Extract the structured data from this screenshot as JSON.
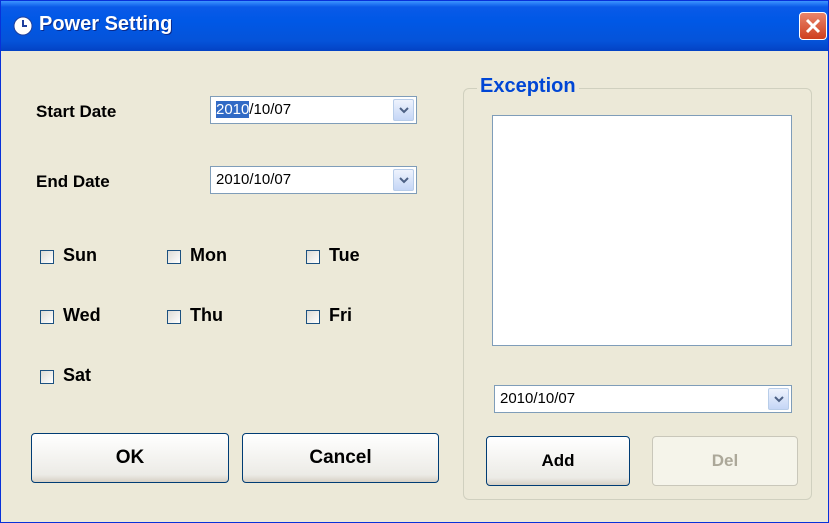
{
  "window": {
    "title": "Power Setting"
  },
  "icons": {
    "title": "clock-icon",
    "close": "close-icon",
    "dropdown": "chevron-down-icon"
  },
  "start_date": {
    "label": "Start Date",
    "value_selected": "2010",
    "value_rest": "/10/07"
  },
  "end_date": {
    "label": "End Date",
    "value": "2010/10/07"
  },
  "days": [
    {
      "label": "Sun",
      "checked": false
    },
    {
      "label": "Mon",
      "checked": false
    },
    {
      "label": "Tue",
      "checked": false
    },
    {
      "label": "Wed",
      "checked": false
    },
    {
      "label": "Thu",
      "checked": false
    },
    {
      "label": "Fri",
      "checked": false
    },
    {
      "label": "Sat",
      "checked": false
    }
  ],
  "buttons": {
    "ok": "OK",
    "cancel": "Cancel"
  },
  "exception": {
    "title": "Exception",
    "items": [],
    "date": "2010/10/07",
    "add": "Add",
    "del": "Del"
  },
  "colors": {
    "titlebar": "#0058e6",
    "face": "#ece9d8",
    "group_title": "#0046d5",
    "selection": "#316ac5"
  }
}
